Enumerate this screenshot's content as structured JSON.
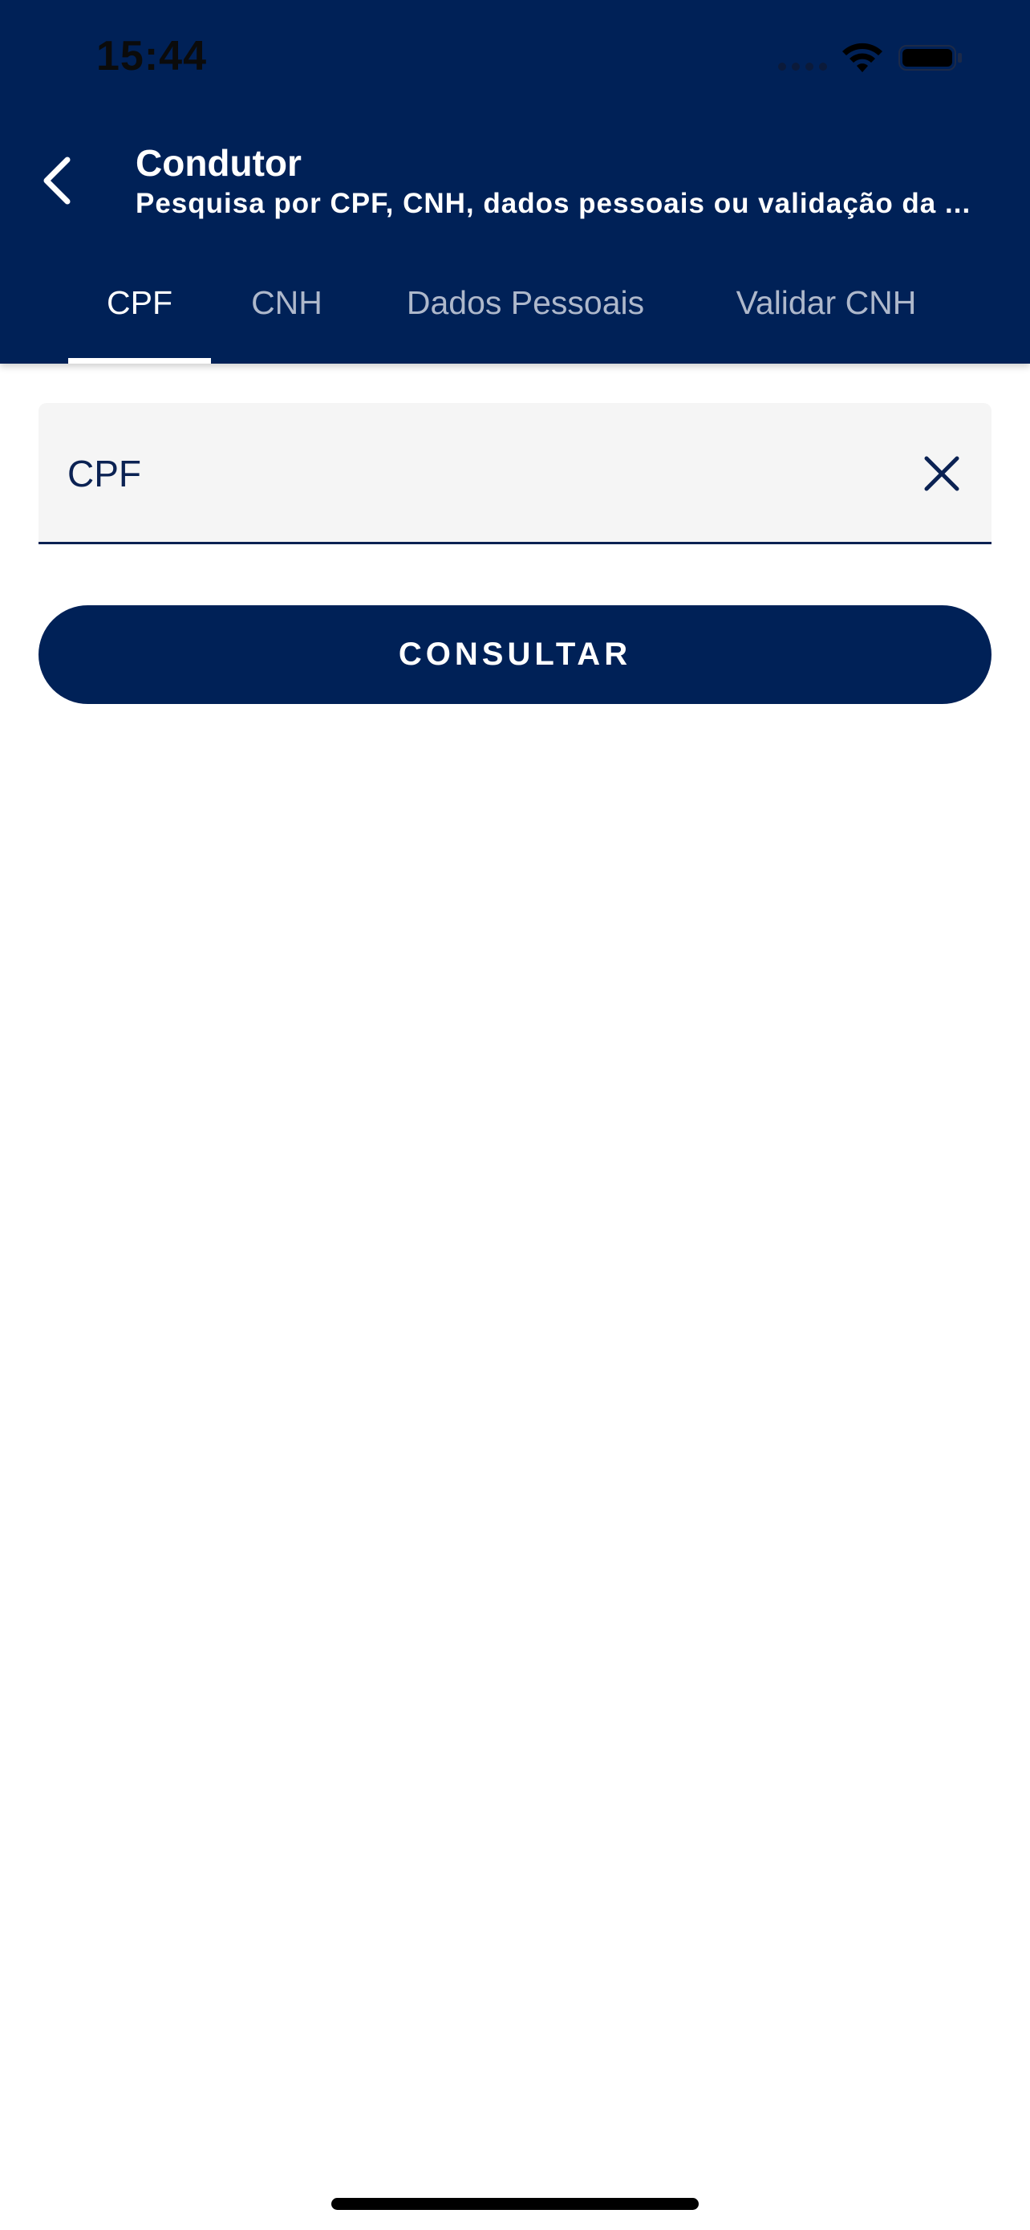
{
  "status_bar": {
    "time": "15:44",
    "icons": [
      "cellular-signal-icon",
      "wifi-icon",
      "battery-icon"
    ]
  },
  "header": {
    "title": "Condutor",
    "subtitle": "Pesquisa por CPF, CNH, dados pessoais ou validação da ...",
    "back_icon": "chevron-left-icon"
  },
  "tabs": [
    {
      "label": "CPF",
      "active": true
    },
    {
      "label": "CNH",
      "active": false
    },
    {
      "label": "Dados Pessoais",
      "active": false
    },
    {
      "label": "Validar CNH",
      "active": false
    }
  ],
  "form": {
    "cpf_field": {
      "placeholder": "CPF",
      "value": "",
      "clear_icon": "close-icon"
    },
    "submit_label": "CONSULTAR"
  },
  "colors": {
    "brand_navy": "#002157",
    "field_background": "#f5f5f5",
    "field_text": "#0b2253",
    "inactive_tab": "#aeb8cb",
    "white": "#ffffff"
  }
}
